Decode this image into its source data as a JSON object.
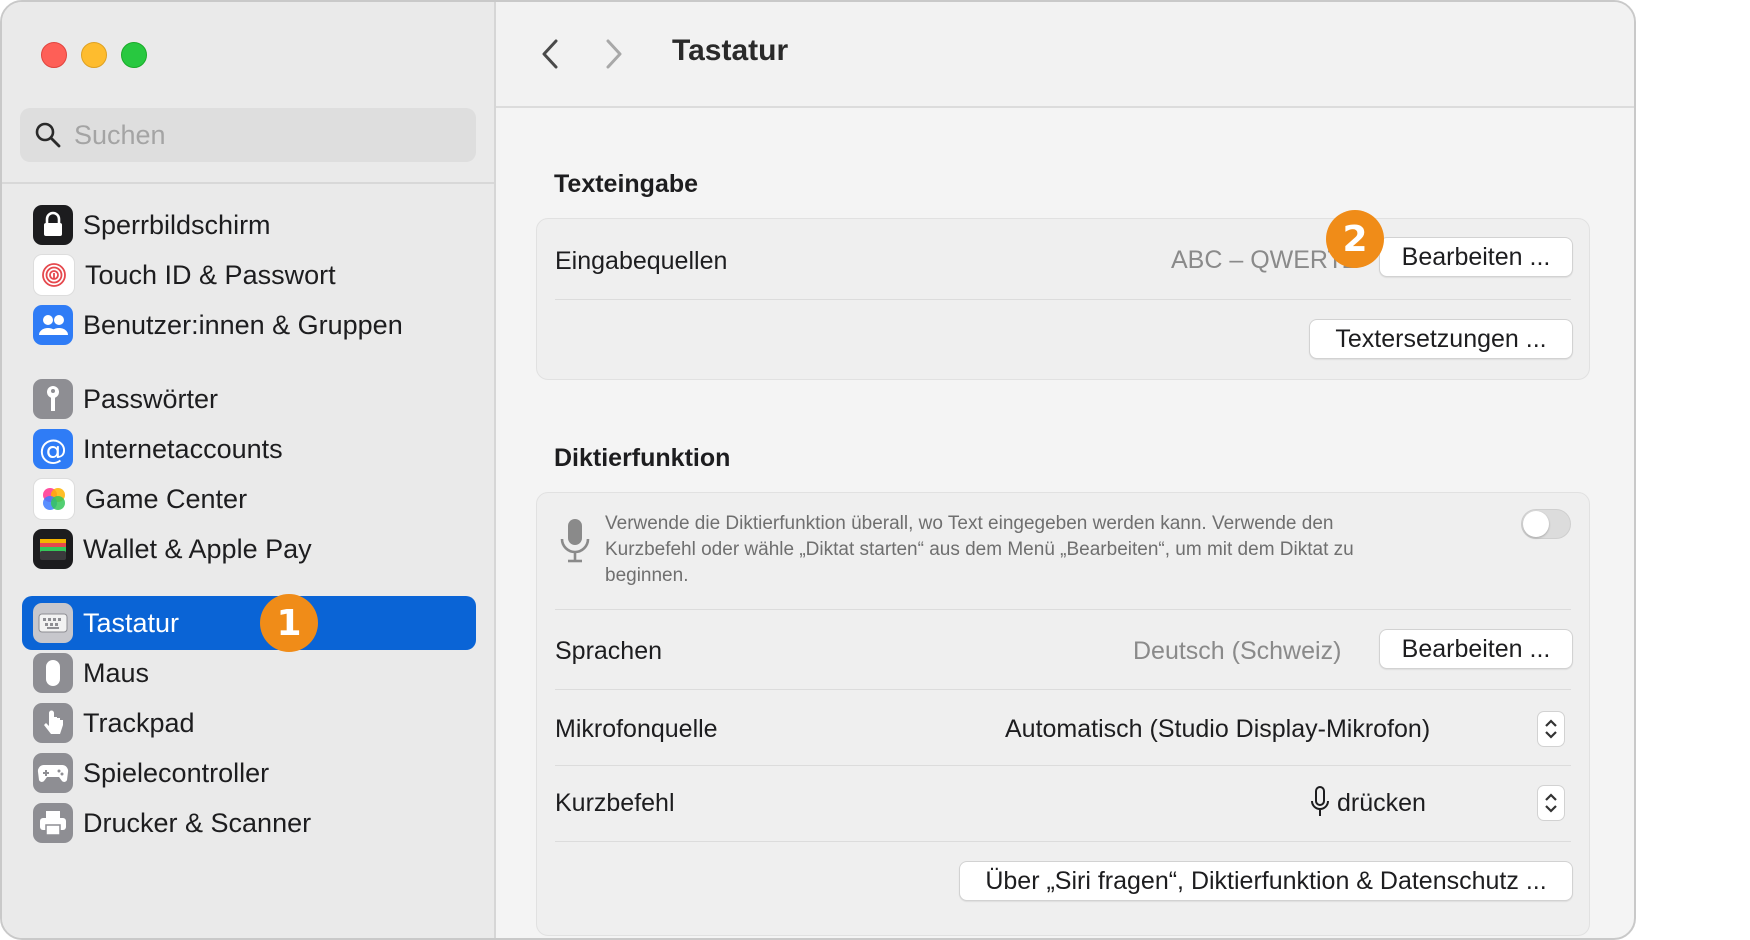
{
  "sidebar": {
    "search_placeholder": "Suchen",
    "items": [
      {
        "label": "Sperrbildschirm",
        "icon": "lock-icon"
      },
      {
        "label": "Touch ID & Passwort",
        "icon": "fingerprint-icon"
      },
      {
        "label": "Benutzer:innen & Gruppen",
        "icon": "users-icon"
      },
      {
        "label": "Passwörter",
        "icon": "key-icon"
      },
      {
        "label": "Internetaccounts",
        "icon": "at-icon"
      },
      {
        "label": "Game Center",
        "icon": "game-center-icon"
      },
      {
        "label": "Wallet & Apple Pay",
        "icon": "wallet-icon"
      },
      {
        "label": "Tastatur",
        "icon": "keyboard-icon",
        "selected": true
      },
      {
        "label": "Maus",
        "icon": "mouse-icon"
      },
      {
        "label": "Trackpad",
        "icon": "trackpad-icon"
      },
      {
        "label": "Spielecontroller",
        "icon": "gamecontroller-icon"
      },
      {
        "label": "Drucker & Scanner",
        "icon": "printer-icon"
      }
    ],
    "badge": "1"
  },
  "header": {
    "title": "Tastatur"
  },
  "texteingabe": {
    "section_title": "Texteingabe",
    "input_sources_label": "Eingabequellen",
    "input_sources_value": "ABC – QWERTZ",
    "edit_button": "Bearbeiten ...",
    "text_replacements_button": "Textersetzungen ...",
    "badge": "2"
  },
  "diktier": {
    "section_title": "Diktierfunktion",
    "description": "Verwende die Diktierfunktion überall, wo Text eingegeben werden kann. Verwende den Kurzbefehl oder wähle „Diktat starten“ aus dem Menü „Bearbeiten“, um mit dem Diktat zu beginnen.",
    "enabled": false,
    "languages_label": "Sprachen",
    "languages_value": "Deutsch (Schweiz)",
    "languages_edit_button": "Bearbeiten ...",
    "mic_label": "Mikrofonquelle",
    "mic_value": "Automatisch (Studio Display-Mikrofon)",
    "shortcut_label": "Kurzbefehl",
    "shortcut_value": "drücken",
    "privacy_button": "Über „Siri fragen“, Diktierfunktion & Datenschutz ..."
  },
  "colors": {
    "accent": "#0a64d6",
    "badge": "#f08c18"
  }
}
